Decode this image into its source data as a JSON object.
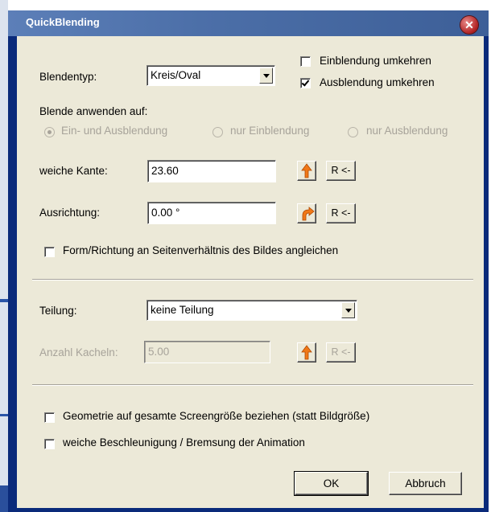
{
  "window": {
    "title": "QuickBlending"
  },
  "blendentyp": {
    "label": "Blendentyp:",
    "value": "Kreis/Oval"
  },
  "einblendung_umkehren": {
    "label": "Einblendung umkehren",
    "checked": false
  },
  "ausblendung_umkehren": {
    "label": "Ausblendung umkehren",
    "checked": true
  },
  "blende_anwenden": {
    "label": "Blende anwenden auf:",
    "options": [
      "Ein- und Ausblendung",
      "nur Einblendung",
      "nur Ausblendung"
    ],
    "selected": "Ein- und Ausblendung"
  },
  "weiche_kante": {
    "label": "weiche Kante:",
    "value": "23.60",
    "reset_label": "R <-"
  },
  "ausrichtung": {
    "label": "Ausrichtung:",
    "value": "0.00 °",
    "reset_label": "R <-"
  },
  "form_richtung": {
    "label": "Form/Richtung an Seitenverhältnis des Bildes angleichen",
    "checked": false
  },
  "teilung": {
    "label": "Teilung:",
    "value": "keine Teilung"
  },
  "anzahl_kacheln": {
    "label": "Anzahl Kacheln:",
    "value": "5.00",
    "reset_label": "R <-"
  },
  "geometrie": {
    "label": "Geometrie auf gesamte Screengröße beziehen (statt Bildgröße)",
    "checked": false
  },
  "weiche_beschleunigung": {
    "label": "weiche Beschleunigung / Bremsung der Animation",
    "checked": false
  },
  "buttons": {
    "ok": "OK",
    "cancel": "Abbruch"
  },
  "colors": {
    "icon_orange": "#f07818",
    "title_bar": "#4c6fa8",
    "dialog_bg": "#ece9d8"
  }
}
